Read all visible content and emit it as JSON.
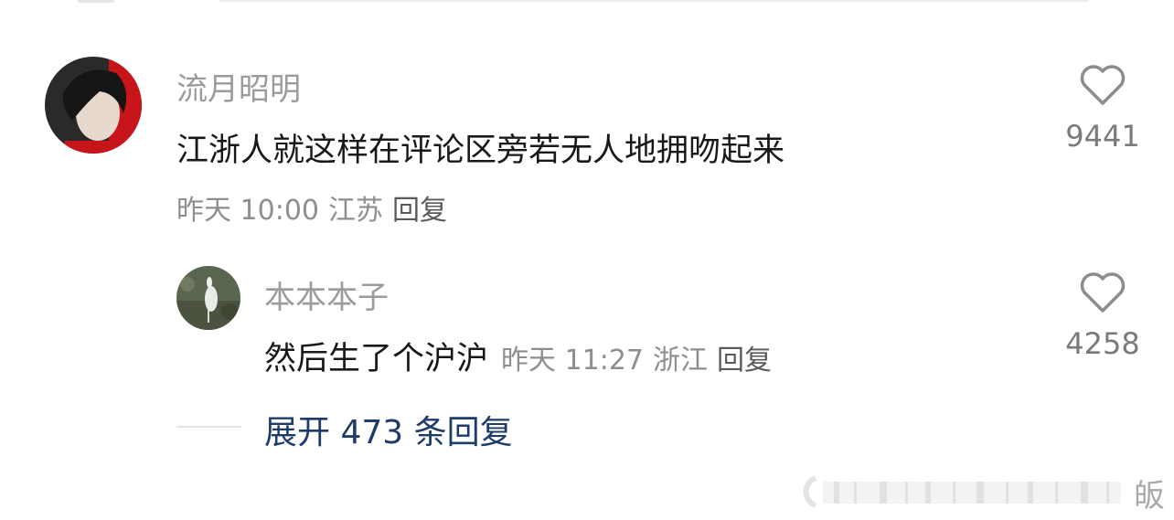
{
  "comment": {
    "username": "流月昭明",
    "content": "江浙人就这样在评论区旁若无人地拥吻起来",
    "time": "昨天 10:00",
    "location": "江苏",
    "reply_label": "回复",
    "likes": "9441"
  },
  "reply": {
    "username": "本本本子",
    "content": "然后生了个沪沪",
    "time": "昨天 11:27",
    "location": "浙江",
    "reply_label": "回复",
    "likes": "4258"
  },
  "expand": {
    "label": "展开 473 条回复"
  },
  "watermark": {
    "char": "皈"
  },
  "colors": {
    "text_primary": "#191919",
    "text_secondary": "#9b9b9b",
    "link_blue": "#1d3c6a"
  },
  "icons": {
    "like": "heart-outline-icon"
  }
}
